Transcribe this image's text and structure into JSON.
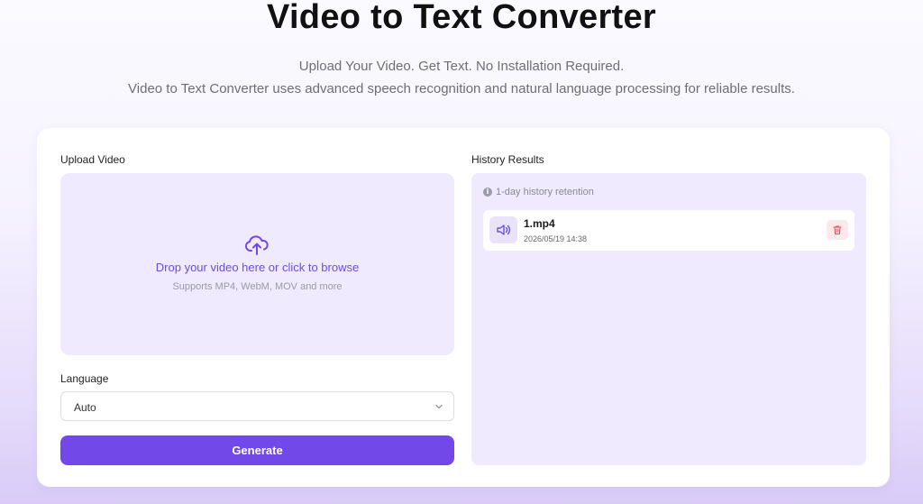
{
  "header": {
    "title": "Video to Text Converter",
    "subtitle_line1": "Upload Your Video. Get Text. No Installation Required.",
    "subtitle_line2": "Video to Text Converter uses advanced speech recognition and natural language processing for reliable results."
  },
  "upload": {
    "label": "Upload Video",
    "drop_title": "Drop your video here or click to browse",
    "drop_hint": "Supports MP4, WebM, MOV and more",
    "icon": "cloud-upload-icon"
  },
  "language": {
    "label": "Language",
    "selected": "Auto"
  },
  "generate": {
    "label": "Generate"
  },
  "history": {
    "label": "History Results",
    "retention": "1-day history retention",
    "items": [
      {
        "name": "1.mp4",
        "date": "2026/05/19 14:38",
        "icon": "speaker-icon"
      }
    ]
  },
  "colors": {
    "accent": "#7248e8",
    "panel": "#efeafd",
    "link": "#6d4ee0",
    "delete_bg": "#fde8ea",
    "delete_icon": "#e0566a"
  }
}
